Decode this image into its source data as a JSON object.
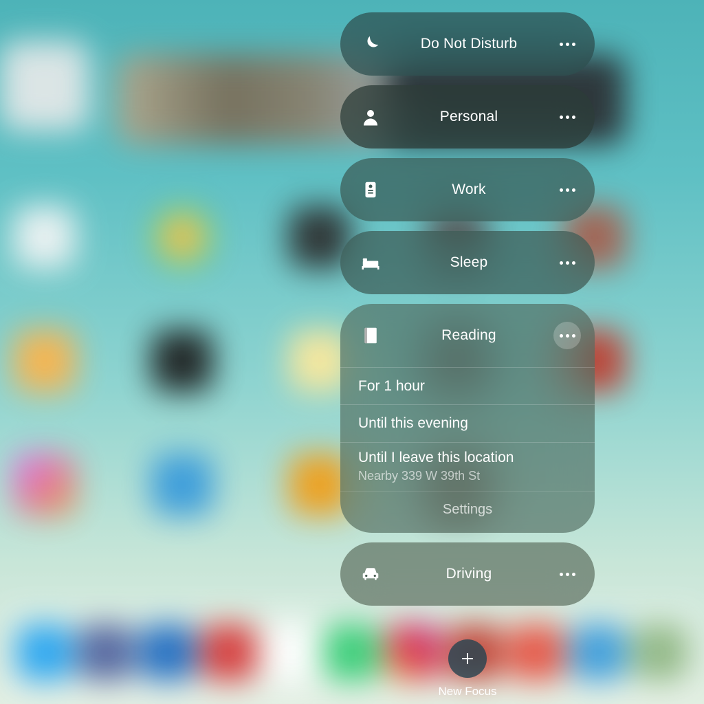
{
  "focus_modes": [
    {
      "label": "Do Not Disturb",
      "icon": "moon"
    },
    {
      "label": "Personal",
      "icon": "person"
    },
    {
      "label": "Work",
      "icon": "badge"
    },
    {
      "label": "Sleep",
      "icon": "bed"
    },
    {
      "label": "Reading",
      "icon": "book"
    },
    {
      "label": "Driving",
      "icon": "car"
    }
  ],
  "expanded": {
    "options": [
      {
        "label": "For 1 hour"
      },
      {
        "label": "Until this evening"
      },
      {
        "label": "Until I leave this location",
        "sub": "Nearby 339 W 39th St"
      }
    ],
    "settings_label": "Settings"
  },
  "footer": {
    "new_focus_label": "New Focus"
  }
}
